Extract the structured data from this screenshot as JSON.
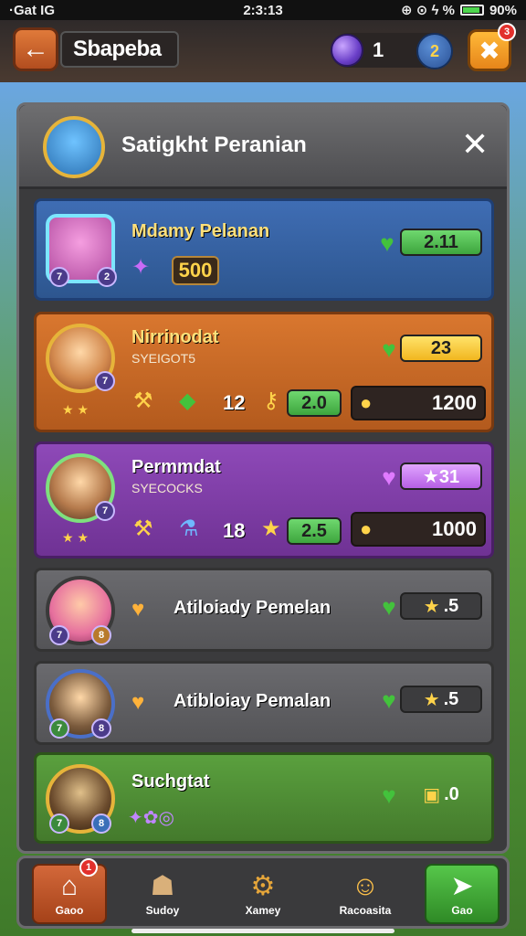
{
  "status_bar": {
    "left": "·Gat IG",
    "time": "2:3:13",
    "right": "⊕ ⊙ ϟ %",
    "battery": "90%"
  },
  "top_bar": {
    "back_icon": "arrow-left-icon",
    "title": "Sbapeba",
    "gem_count": "1",
    "coin_label": "2",
    "close_badge": "3"
  },
  "panel": {
    "title": "Satigkht Peranian",
    "close_label": "✕"
  },
  "cards": [
    {
      "name": "Mdamy Pelanan",
      "badge_left": "7",
      "badge_right": "2",
      "value": "500",
      "pill_value": "2.11",
      "color": "#3f6db4"
    },
    {
      "name": "Nirrinodat",
      "subtitle": "SYEIGOT5",
      "badge": "7",
      "pill_value": "23",
      "stat_1": "12",
      "stat_2": "2.0",
      "stat_3": "1200",
      "color": "#d9772f"
    },
    {
      "name": "Permmdat",
      "subtitle": "SYECOCKS",
      "badge": "7",
      "pill_value": "★31",
      "stat_1": "18",
      "stat_2": "2.5",
      "stat_3": "1000",
      "color": "#8e49b8"
    },
    {
      "name": "Atiloiady Pemelan",
      "badge_left": "7",
      "badge_right": "8",
      "pill_value": ".5",
      "color": "#6a6a6e"
    },
    {
      "name": "Atibloiay Pemalan",
      "badge_left": "7",
      "badge_right": "8",
      "pill_value": ".5",
      "color": "#6a6a6e"
    },
    {
      "name": "Suchgtat",
      "badge_left": "7",
      "badge_right": "8",
      "pill_value": ".0",
      "color": "#5aa03e"
    }
  ],
  "bottom_nav": [
    {
      "label": "Gaoo",
      "icon": "home-icon",
      "badge": "1"
    },
    {
      "label": "Sudoy",
      "icon": "shop-icon"
    },
    {
      "label": "Xamey",
      "icon": "gear-icon"
    },
    {
      "label": "Racoasita",
      "icon": "smile-icon"
    },
    {
      "label": "Gao",
      "icon": "go-arrow-icon"
    }
  ]
}
